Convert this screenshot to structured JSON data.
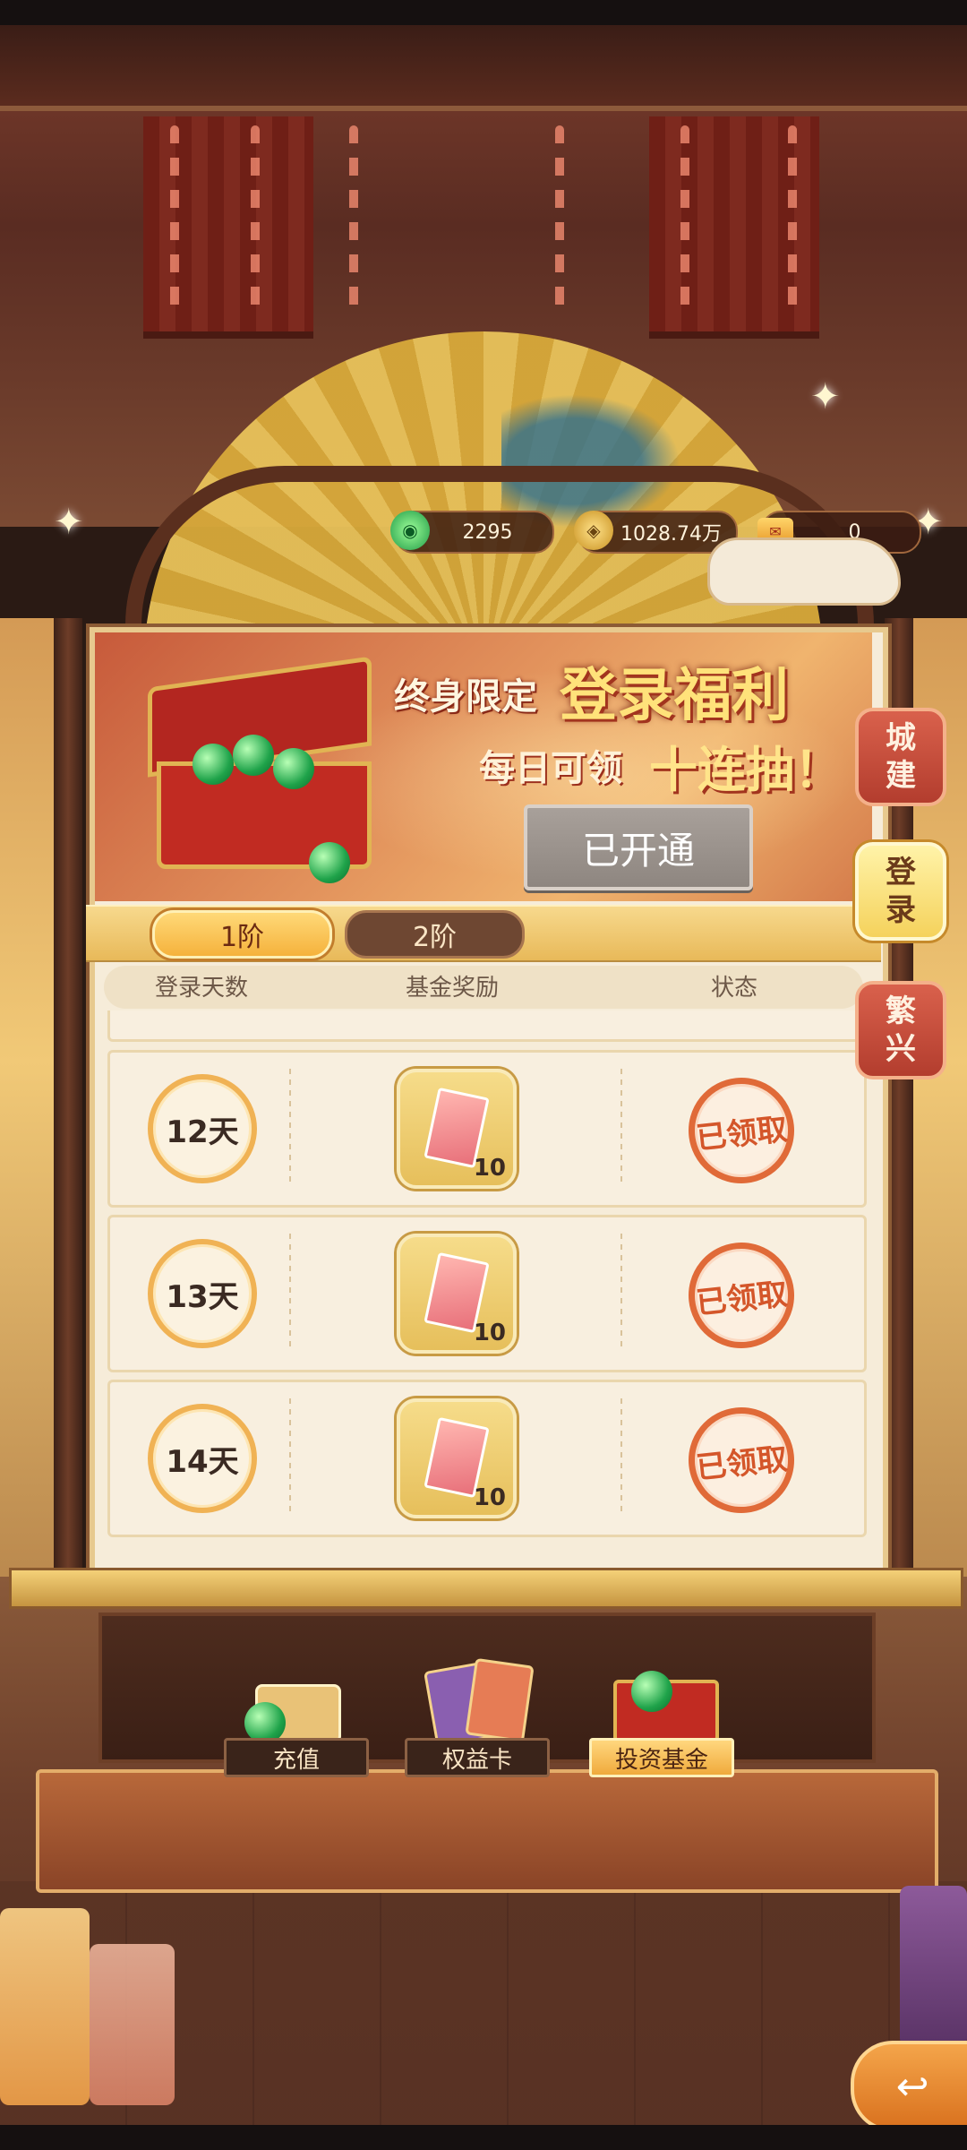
{
  "currencies": [
    {
      "icon": "jade-coin-icon",
      "value": "2295"
    },
    {
      "icon": "copper-coin-icon",
      "value": "1028.74万"
    },
    {
      "icon": "ticket-icon",
      "value": "0"
    }
  ],
  "banner": {
    "title_small": "终身限定",
    "title_large": "登录福利",
    "sub_small": "每日可领",
    "sub_large": "十连抽！",
    "status_button": "已开通"
  },
  "tiers": [
    "1阶",
    "2阶"
  ],
  "table": {
    "headers": [
      "登录天数",
      "基金奖励",
      "状态"
    ],
    "rows": [
      {
        "day": "12天",
        "reward_count": "10",
        "status": "已领取"
      },
      {
        "day": "13天",
        "reward_count": "10",
        "status": "已领取"
      },
      {
        "day": "14天",
        "reward_count": "10",
        "status": "已领取"
      }
    ]
  },
  "side_tabs": [
    {
      "label": [
        "城",
        "建"
      ],
      "active": false
    },
    {
      "label": [
        "登",
        "录"
      ],
      "active": true
    },
    {
      "label": [
        "繁",
        "兴"
      ],
      "active": false
    }
  ],
  "bottom_buttons": [
    {
      "label": "充值",
      "active": false
    },
    {
      "label": "权益卡",
      "active": false
    },
    {
      "label": "投资基金",
      "active": true
    }
  ],
  "colors": {
    "accent_gold": "#f0b254",
    "stamp_red": "#e06a38",
    "banner_orange": "#e2925c"
  }
}
